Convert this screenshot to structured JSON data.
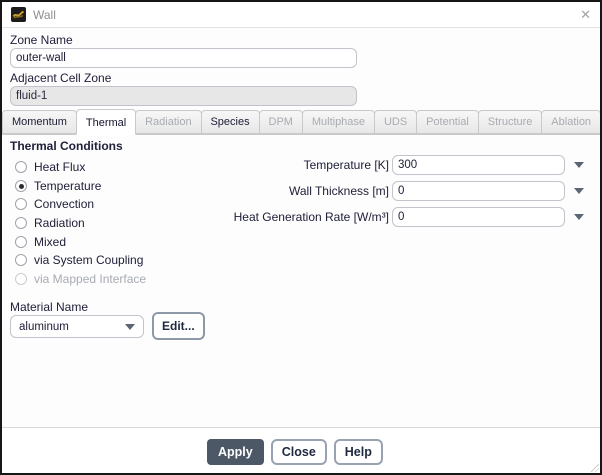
{
  "window": {
    "title": "Wall",
    "close_label": "✕"
  },
  "zone_name": {
    "label": "Zone Name",
    "value": "outer-wall"
  },
  "adjacent_cell_zone": {
    "label": "Adjacent Cell Zone",
    "value": "fluid-1"
  },
  "tabs": [
    {
      "id": "momentum",
      "label": "Momentum",
      "active": false,
      "enabled": true
    },
    {
      "id": "thermal",
      "label": "Thermal",
      "active": true,
      "enabled": true
    },
    {
      "id": "radiation",
      "label": "Radiation",
      "active": false,
      "enabled": false
    },
    {
      "id": "species",
      "label": "Species",
      "active": false,
      "enabled": true
    },
    {
      "id": "dpm",
      "label": "DPM",
      "active": false,
      "enabled": false
    },
    {
      "id": "multiphase",
      "label": "Multiphase",
      "active": false,
      "enabled": false
    },
    {
      "id": "uds",
      "label": "UDS",
      "active": false,
      "enabled": false
    },
    {
      "id": "potential",
      "label": "Potential",
      "active": false,
      "enabled": false
    },
    {
      "id": "structure",
      "label": "Structure",
      "active": false,
      "enabled": false
    },
    {
      "id": "ablation",
      "label": "Ablation",
      "active": false,
      "enabled": false
    }
  ],
  "thermal_tab": {
    "heading": "Thermal Conditions",
    "conditions": [
      {
        "id": "heat-flux",
        "label": "Heat Flux",
        "selected": false,
        "enabled": true
      },
      {
        "id": "temperature",
        "label": "Temperature",
        "selected": true,
        "enabled": true
      },
      {
        "id": "convection",
        "label": "Convection",
        "selected": false,
        "enabled": true
      },
      {
        "id": "radiation",
        "label": "Radiation",
        "selected": false,
        "enabled": true
      },
      {
        "id": "mixed",
        "label": "Mixed",
        "selected": false,
        "enabled": true
      },
      {
        "id": "via-system-coupling",
        "label": "via System Coupling",
        "selected": false,
        "enabled": true
      },
      {
        "id": "via-mapped-interface",
        "label": "via Mapped Interface",
        "selected": false,
        "enabled": false
      }
    ],
    "fields": [
      {
        "id": "temperature",
        "label": "Temperature [K]",
        "value": "300"
      },
      {
        "id": "wall-thickness",
        "label": "Wall Thickness [m]",
        "value": "0"
      },
      {
        "id": "heat-generation-rate",
        "label": "Heat Generation Rate [W/m³]",
        "value": "0"
      }
    ],
    "material": {
      "label": "Material Name",
      "value": "aluminum",
      "edit_button": "Edit..."
    }
  },
  "footer": {
    "apply": "Apply",
    "close": "Close",
    "help": "Help"
  }
}
